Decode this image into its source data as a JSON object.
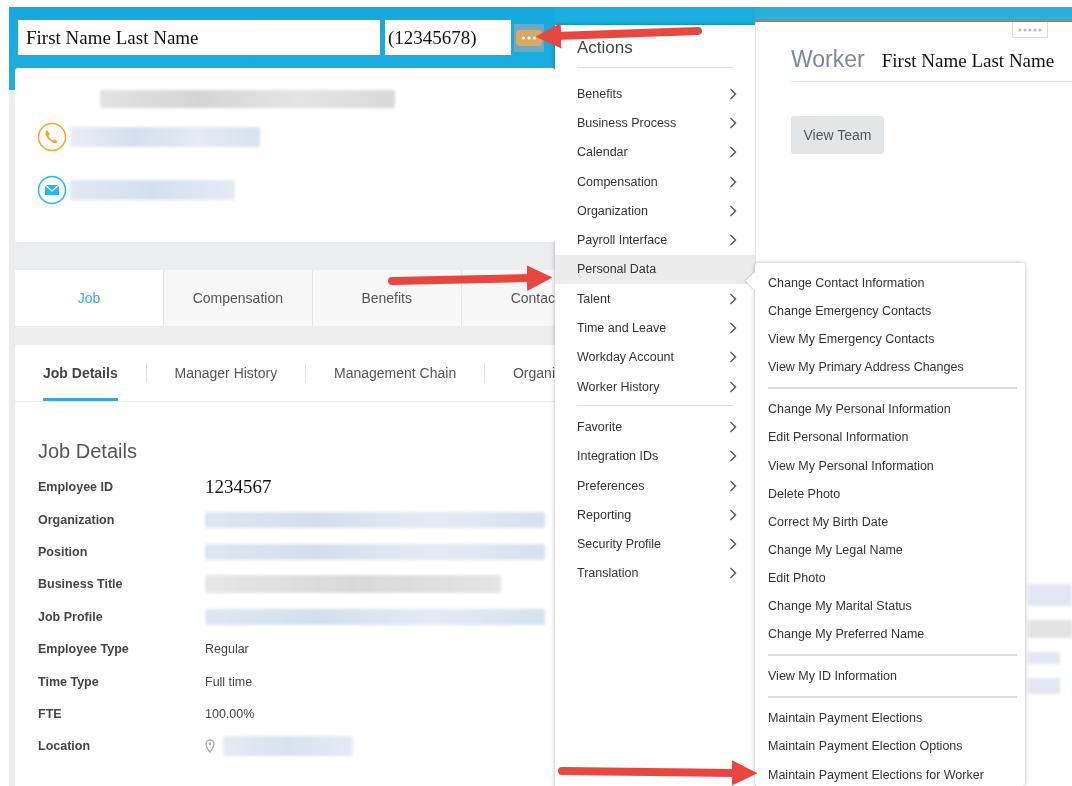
{
  "profile_header": {
    "name": "First Name Last Name",
    "employee_number": "(12345678)"
  },
  "tabs": [
    {
      "label": "Job",
      "selected": true
    },
    {
      "label": "Compensation",
      "selected": false
    },
    {
      "label": "Benefits",
      "selected": false
    },
    {
      "label": "Contac",
      "selected": false
    }
  ],
  "subtabs": [
    {
      "label": "Job Details",
      "selected": true
    },
    {
      "label": "Manager History",
      "selected": false
    },
    {
      "label": "Management Chain",
      "selected": false
    },
    {
      "label": "Organi",
      "selected": false
    }
  ],
  "job_details": {
    "title": "Job Details",
    "fields": [
      {
        "label": "Employee ID",
        "kind": "serif",
        "value": "1234567"
      },
      {
        "label": "Organization",
        "kind": "redacted_link"
      },
      {
        "label": "Position",
        "kind": "redacted_link"
      },
      {
        "label": "Business Title",
        "kind": "redacted_text"
      },
      {
        "label": "Job Profile",
        "kind": "redacted_link"
      },
      {
        "label": "Employee Type",
        "kind": "text",
        "value": "Regular"
      },
      {
        "label": "Time Type",
        "kind": "text",
        "value": "Full time"
      },
      {
        "label": "FTE",
        "kind": "text",
        "value": "100.00%"
      },
      {
        "label": "Location",
        "kind": "location"
      }
    ]
  },
  "actions_menu": {
    "title": "Actions",
    "groups": [
      [
        {
          "label": "Benefits",
          "selected": false
        },
        {
          "label": "Business Process",
          "selected": false
        },
        {
          "label": "Calendar",
          "selected": false
        },
        {
          "label": "Compensation",
          "selected": false
        },
        {
          "label": "Organization",
          "selected": false
        },
        {
          "label": "Payroll Interface",
          "selected": false
        },
        {
          "label": "Personal Data",
          "selected": true
        },
        {
          "label": "Talent",
          "selected": false
        },
        {
          "label": "Time and Leave",
          "selected": false
        },
        {
          "label": "Workday Account",
          "selected": false
        },
        {
          "label": "Worker History",
          "selected": false
        }
      ],
      [
        {
          "label": "Favorite",
          "selected": false
        },
        {
          "label": "Integration IDs",
          "selected": false
        },
        {
          "label": "Preferences",
          "selected": false
        },
        {
          "label": "Reporting",
          "selected": false
        },
        {
          "label": "Security Profile",
          "selected": false
        },
        {
          "label": "Translation",
          "selected": false
        }
      ]
    ]
  },
  "submenu": {
    "groups": [
      [
        "Change Contact Information",
        "Change Emergency Contacts",
        "View My Emergency Contacts",
        "View My Primary Address Changes"
      ],
      [
        "Change My Personal Information",
        "Edit Personal Information",
        "View My Personal Information",
        "Delete Photo",
        "Correct My Birth Date",
        "Change My Legal Name",
        "Edit Photo",
        "Change My Marital Status",
        "Change My Preferred Name"
      ],
      [
        "View My ID Information"
      ],
      [
        "Maintain Payment Elections",
        "Maintain Payment Election Options",
        "Maintain Payment Elections for Worker"
      ]
    ]
  },
  "worker_panel": {
    "label": "Worker",
    "name": "First Name Last Name",
    "button": "View Team"
  }
}
